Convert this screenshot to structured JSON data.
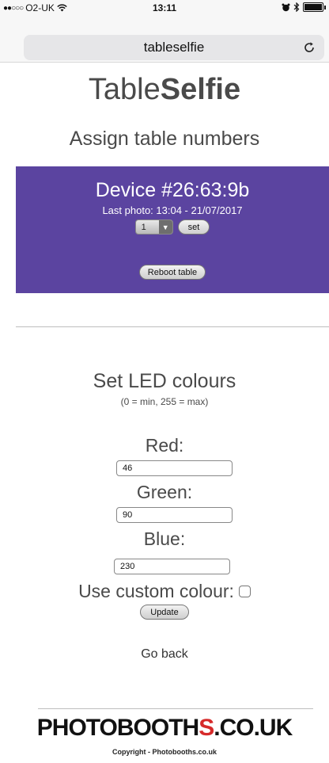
{
  "status_bar": {
    "carrier": "O2-UK",
    "time": "13:11"
  },
  "browser": {
    "address": "tableselfie"
  },
  "site": {
    "title_light": "Table",
    "title_bold": "Selfie",
    "heading": "Assign table numbers"
  },
  "device": {
    "name": "Device #26:63:9b",
    "last_photo": "Last photo: 13:04 - 21/07/2017",
    "table_number": "1",
    "set_label": "set",
    "reboot_label": "Reboot table"
  },
  "led": {
    "heading": "Set LED colours",
    "note": "(0 = min, 255 = max)",
    "red_label": "Red:",
    "red_value": "46",
    "green_label": "Green:",
    "green_value": "90",
    "blue_label": "Blue:",
    "blue_value": "230",
    "custom_label": "Use custom colour:",
    "custom_checked": false,
    "update_label": "Update"
  },
  "nav": {
    "go_back": "Go back"
  },
  "footer": {
    "brand_part1": "PHOTOBOOTH",
    "brand_accent": "S",
    "brand_part2": ".CO.UK",
    "copyright": "Copyright - Photobooths.co.uk"
  },
  "colors": {
    "panel": "#5b44a0",
    "brand_accent": "#d62a2a"
  }
}
